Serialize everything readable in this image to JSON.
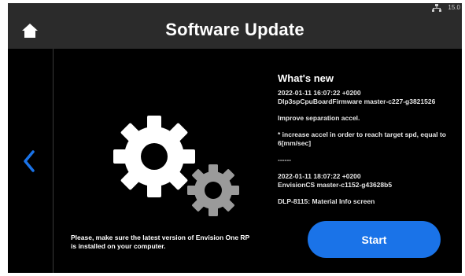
{
  "status_bar": {
    "version": "15.0",
    "icon": "network-icon"
  },
  "header": {
    "title": "Software Update",
    "home_icon": "home-icon"
  },
  "nav": {
    "back_icon": "chevron-left-icon"
  },
  "illustration": {
    "icon": "gears-icon"
  },
  "notice": {
    "line1": "Please, make sure the latest version of Envision One RP",
    "line2": "is installed on your computer."
  },
  "whats_new": {
    "title": "What's new",
    "entries": [
      "2022-01-11 16:07:22 +0200",
      "Dlp3spCpuBoardFirmware master-c227-g3821526",
      "Improve separation accel.",
      "* increase accel in order to reach target spd, equal to 6[mm/sec]",
      "------",
      "2022-01-11 18:07:22 +0200",
      "EnvisionCS master-c1152-g43628b5",
      "DLP-8115: Material Info screen"
    ]
  },
  "actions": {
    "start_label": "Start"
  },
  "colors": {
    "accent": "#1a73e8",
    "header_bg": "#2b2b2b",
    "background": "#000000",
    "gear_large": "#ffffff",
    "gear_small": "#9a9a9a"
  }
}
